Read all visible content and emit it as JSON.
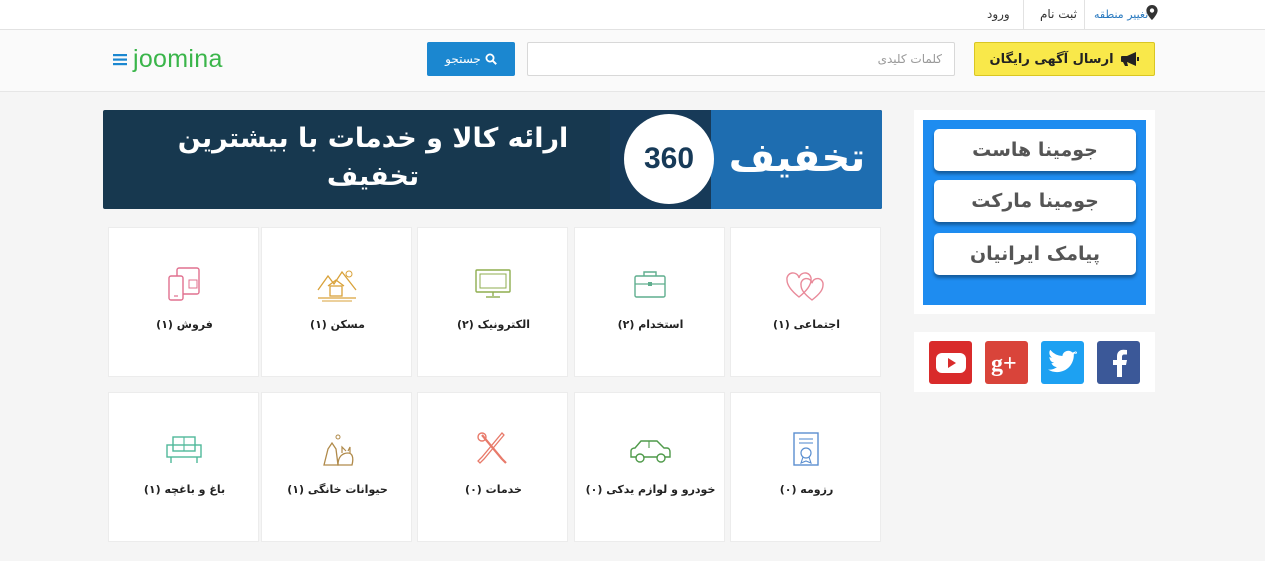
{
  "topbar": {
    "change_region": "تغییر منطقه",
    "register": "ثبت نام",
    "login": "ورود"
  },
  "header": {
    "post_ad_label": "ارسال آگهی رایگان",
    "search_placeholder": "کلمات کلیدی",
    "search_button": "جستجو",
    "logo": "joomina"
  },
  "banner": {
    "headline_line1": "ارائه کالا و خدمات با بیشترین",
    "headline_line2": "تخفیف",
    "logo_number": "360",
    "logo_word": "تخفیف"
  },
  "categories": [
    {
      "label": "اجتماعی (۱)",
      "icon": "hearts-icon"
    },
    {
      "label": "استخدام (۲)",
      "icon": "briefcase-icon"
    },
    {
      "label": "الکترونیک (۲)",
      "icon": "monitor-icon"
    },
    {
      "label": "مسکن (۱)",
      "icon": "house-landscape-icon"
    },
    {
      "label": "فروش (۱)",
      "icon": "devices-icon"
    },
    {
      "label": "رزومه (۰)",
      "icon": "certificate-icon"
    },
    {
      "label": "خودرو و لوازم یدکی (۰)",
      "icon": "car-icon"
    },
    {
      "label": "خدمات (۰)",
      "icon": "tools-icon"
    },
    {
      "label": "حیوانات خانگی (۱)",
      "icon": "pets-icon"
    },
    {
      "label": "باغ و باغچه (۱)",
      "icon": "sofa-icon"
    }
  ],
  "sidebar": {
    "links": [
      "جومینا هاست",
      "جومینا مارکت",
      "پیامک ایرانیان"
    ]
  },
  "social": [
    "facebook-icon",
    "twitter-icon",
    "google-plus-icon",
    "youtube-icon"
  ],
  "colors": {
    "accent_blue": "#1b87d0",
    "post_ad_yellow": "#f9e84a",
    "logo_green": "#3ab54a",
    "sidebar_blue": "#1e8cf0"
  }
}
